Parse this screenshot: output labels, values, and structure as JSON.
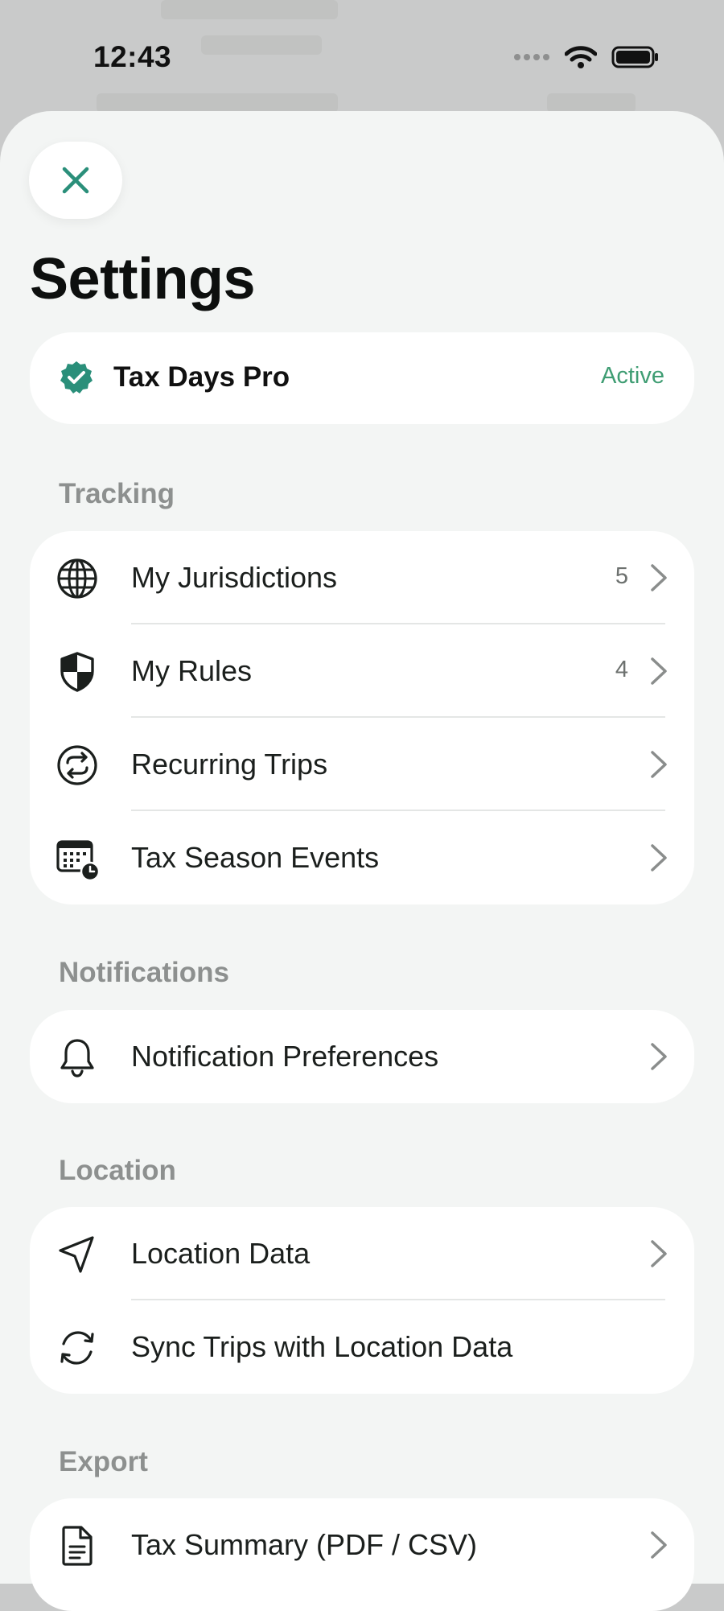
{
  "status_bar": {
    "time": "12:43"
  },
  "settings": {
    "title": "Settings",
    "pro": {
      "name": "Tax Days Pro",
      "status": "Active"
    },
    "sections": [
      {
        "label": "Tracking",
        "rows": [
          {
            "label": "My Jurisdictions",
            "count": "5",
            "icon": "globe-icon"
          },
          {
            "label": "My Rules",
            "count": "4",
            "icon": "shield-icon"
          },
          {
            "label": "Recurring Trips",
            "icon": "repeat-icon"
          },
          {
            "label": "Tax Season Events",
            "icon": "calendar-clock-icon"
          }
        ]
      },
      {
        "label": "Notifications",
        "rows": [
          {
            "label": "Notification Preferences",
            "icon": "bell-icon"
          }
        ]
      },
      {
        "label": "Location",
        "rows": [
          {
            "label": "Location Data",
            "icon": "location-arrow-icon"
          },
          {
            "label": "Sync Trips with Location Data",
            "icon": "sync-icon"
          }
        ]
      },
      {
        "label": "Export",
        "rows": [
          {
            "label": "Tax Summary (PDF / CSV)",
            "icon": "document-icon"
          }
        ]
      }
    ]
  },
  "colors": {
    "accent": "#2a8f7a",
    "active": "#3f9d73",
    "background": "#f3f5f4"
  }
}
